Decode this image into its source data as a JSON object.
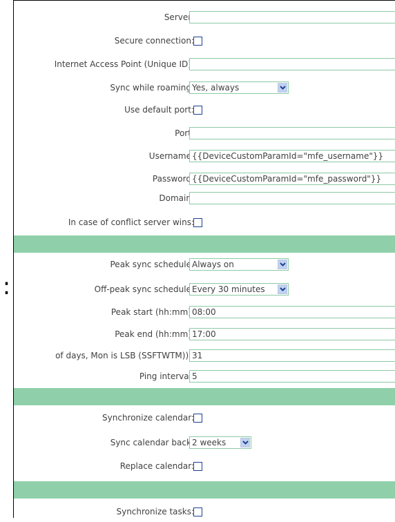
{
  "section1": {
    "server": {
      "label": "Server:",
      "value": ""
    },
    "secure": {
      "label": "Secure connection:"
    },
    "iap": {
      "label": "Internet Access Point (Unique ID):",
      "value": ""
    },
    "roaming": {
      "label": "Sync while roaming:",
      "selected": "Yes, always"
    },
    "default_port": {
      "label": "Use default port:"
    },
    "port": {
      "label": "Port:",
      "value": ""
    },
    "username": {
      "label": "Username:",
      "value": "{{DeviceCustomParamId=\"mfe_username\"}}"
    },
    "password": {
      "label": "Password:",
      "value": "{{DeviceCustomParamId=\"mfe_password\"}}"
    },
    "domain": {
      "label": "Domain:",
      "value": ""
    },
    "conflict": {
      "label": "In case of conflict server wins:"
    }
  },
  "section2": {
    "peak_schedule": {
      "label": "Peak sync schedule:",
      "selected": "Always on"
    },
    "offpeak_schedule": {
      "label": "Off-peak sync schedule:",
      "selected": "Every 30 minutes"
    },
    "peak_start": {
      "label": "Peak start (hh:mm):",
      "value": "08:00"
    },
    "peak_end": {
      "label": "Peak end (hh:mm):",
      "value": "17:00"
    },
    "days": {
      "label": "of days, Mon is LSB (SSFTWTM)) :",
      "value": "31"
    },
    "ping": {
      "label": "Ping interval:",
      "value": "5"
    }
  },
  "section3": {
    "sync_calendar": {
      "label": "Synchronize calendar:"
    },
    "calendar_back": {
      "label": "Sync calendar back:",
      "selected": "2 weeks"
    },
    "replace_calendar": {
      "label": "Replace calendar:"
    }
  },
  "section4": {
    "sync_tasks": {
      "label": "Synchronize tasks:"
    }
  },
  "colors": {
    "band": "#8fd0aa",
    "input_border": "#8cc9a3",
    "checkbox_border": "#1c3f94"
  }
}
